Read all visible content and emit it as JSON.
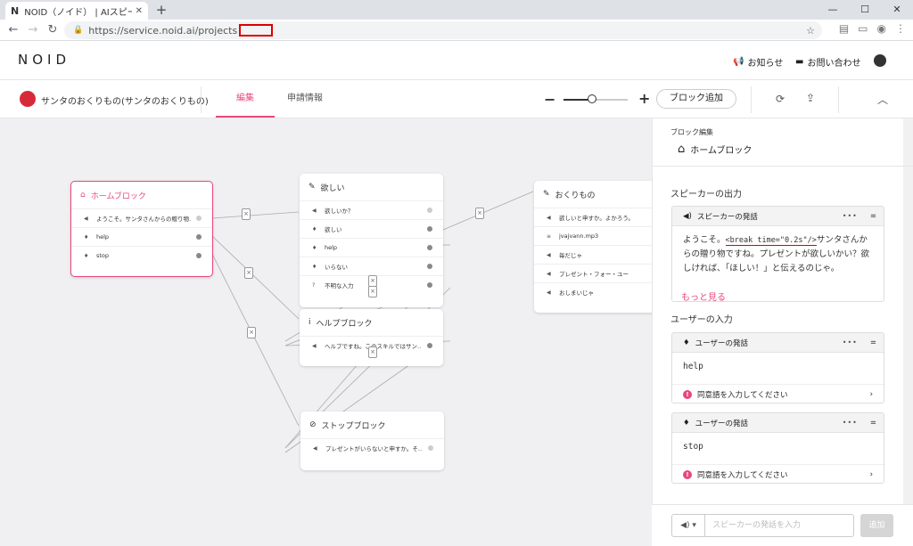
{
  "browser": {
    "tab_title": "NOID（ノイド） | AIスピーカースキル",
    "tab_favicon": "N",
    "new_tab": "+",
    "url": "https://service.noid.ai/projects",
    "window_controls": [
      "—",
      "☐",
      "✕"
    ]
  },
  "header": {
    "logo": "NOID",
    "news_label": "お知らせ",
    "contact_label": "お問い合わせ"
  },
  "toolbar": {
    "project_name": "サンタのおくりもの(サンタのおくりもの)",
    "tabs": [
      {
        "label": "編集"
      },
      {
        "label": "申請情報"
      }
    ],
    "zoom_minus": "−",
    "zoom_plus": "+",
    "zoom_level": 0.45,
    "add_block_label": "ブロック追加"
  },
  "blocks": {
    "home": {
      "title": "ホームブロック",
      "rows": [
        "ようこそ。サンタさんからの贈り物…",
        "help",
        "stop"
      ]
    },
    "hoshii": {
      "title": "欲しい",
      "rows": [
        "欲しいか？",
        "欲しい",
        "help",
        "いらない",
        "不明な入力"
      ]
    },
    "okurimono": {
      "title": "おくりもの",
      "rows": [
        "欲しいと申すか。よかろう。",
        "jvajvann.mp3",
        "毎だじゃ",
        "プレゼント・フォー・ユー",
        "おしまいじゃ"
      ]
    },
    "help": {
      "title": "ヘルプブロック",
      "rows": [
        "ヘルプですね。このスキルではサン…"
      ]
    },
    "stop": {
      "title": "ストップブロック",
      "rows": [
        "プレゼントがいらないと申すか。そ…"
      ]
    },
    "connector_label": "×"
  },
  "panel": {
    "header_label": "ブロック編集",
    "header_title": "ホームブロック",
    "speaker_section": "スピーカーの出力",
    "speaker_card": {
      "title": "スピーカーの発話",
      "text_before": "ようこそ。",
      "code": "<break time=\"0.2s\"/>",
      "text_after": "サンタさんからの贈り物ですね。プレゼントが欲しいかい？欲しければ、「ほしい！」と伝えるのじゃ。"
    },
    "more_label": "もっと見る",
    "user_section": "ユーザーの入力",
    "user_cards": [
      {
        "title": "ユーザーの発話",
        "value": "help",
        "synonym": "同意語を入力してください"
      },
      {
        "title": "ユーザーの発話",
        "value": "stop",
        "synonym": "同意語を入力してください"
      }
    ],
    "menu_dots": "•••",
    "drag_handle": "="
  },
  "input_bar": {
    "select_label": "◀) ▾",
    "placeholder": "スピーカーの発話を入力",
    "add_label": "追加"
  },
  "colors": {
    "accent": "#e8487a",
    "project_icon": "#d62a3b",
    "annotation": "#dd0000"
  }
}
